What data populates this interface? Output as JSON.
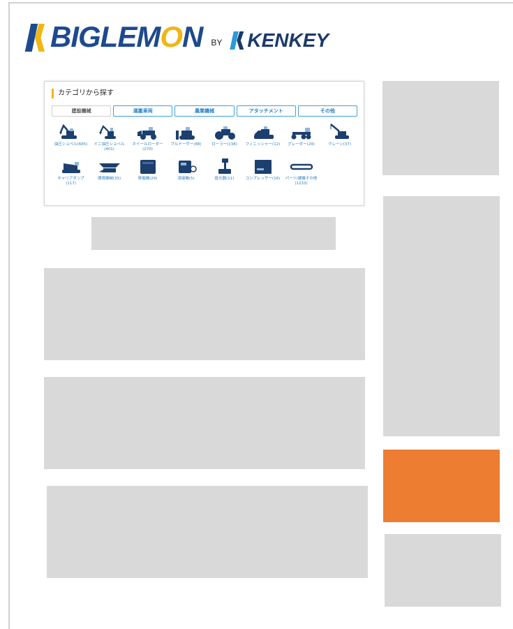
{
  "header": {
    "brand": "BIGLEMON",
    "by": "BY",
    "partner": "KENKEY"
  },
  "category": {
    "title": "カテゴリから探す",
    "tabs": [
      "建設機械",
      "運搬車両",
      "農業機械",
      "アタッチメント",
      "その他"
    ],
    "items": [
      {
        "label": "油圧ショベル(665)",
        "icon": "excavator-icon"
      },
      {
        "label": "ミニ油圧ショベル(401)",
        "icon": "mini-excavator-icon"
      },
      {
        "label": "ホイールローダー(270)",
        "icon": "wheel-loader-icon"
      },
      {
        "label": "ブルドーザー(88)",
        "icon": "bulldozer-icon"
      },
      {
        "label": "ローラー(138)",
        "icon": "roller-icon"
      },
      {
        "label": "フィニッシャー(12)",
        "icon": "finisher-icon"
      },
      {
        "label": "グレーダー(29)",
        "icon": "grader-icon"
      },
      {
        "label": "クレーン(37)",
        "icon": "crane-icon"
      },
      {
        "label": "キャリアダンプ(117)",
        "icon": "carrier-dump-icon"
      },
      {
        "label": "環境機械(35)",
        "icon": "environment-machine-icon"
      },
      {
        "label": "発電機(29)",
        "icon": "generator-icon"
      },
      {
        "label": "溶接機(5)",
        "icon": "welder-icon"
      },
      {
        "label": "投光器(11)",
        "icon": "floodlight-icon"
      },
      {
        "label": "コンプレッサー(16)",
        "icon": "compressor-icon"
      },
      {
        "label": "パーツ/建機その他(1233)",
        "icon": "parts-icon"
      }
    ]
  },
  "colors": {
    "brand_blue": "#1d4a8f",
    "brand_yellow": "#f2b515",
    "tab_blue": "#3fa2da",
    "placeholder": "#d9d9d9",
    "accent_orange": "#ed7d31"
  }
}
